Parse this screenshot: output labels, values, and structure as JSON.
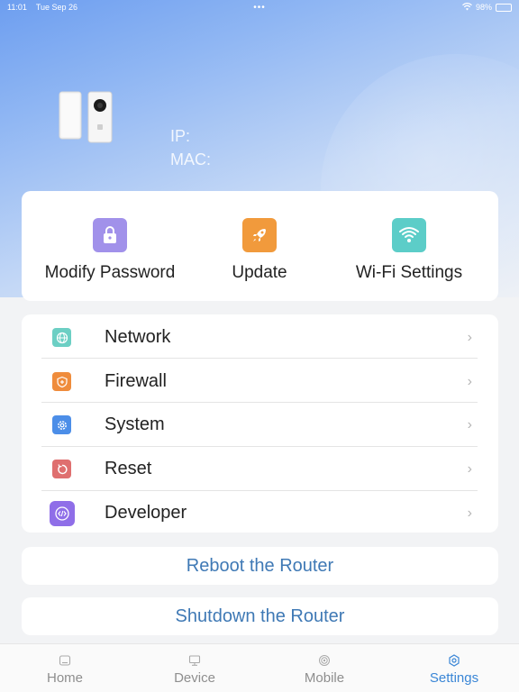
{
  "status_bar": {
    "time": "11:01",
    "date": "Tue Sep 26",
    "battery": "98%"
  },
  "device": {
    "ip_label": "IP:",
    "mac_label": "MAC:"
  },
  "quick_actions": [
    {
      "label": "Modify Password",
      "icon": "lock-icon",
      "color": "#a191ea"
    },
    {
      "label": "Update",
      "icon": "rocket-icon",
      "color": "#f19a3c"
    },
    {
      "label": "Wi-Fi Settings",
      "icon": "wifi-icon",
      "color": "#5ccdc8"
    }
  ],
  "menu": [
    {
      "label": "Network",
      "icon": "globe-icon",
      "color": "#6ccfc4"
    },
    {
      "label": "Firewall",
      "icon": "shield-icon",
      "color": "#ef8c3c"
    },
    {
      "label": "System",
      "icon": "gear-icon",
      "color": "#4c8ee8"
    },
    {
      "label": "Reset",
      "icon": "reset-icon",
      "color": "#df6f6f"
    },
    {
      "label": "Developer",
      "icon": "code-icon",
      "color": "#8f6ee8"
    }
  ],
  "actions": {
    "reboot": "Reboot the Router",
    "shutdown": "Shutdown the Router"
  },
  "tabs": [
    {
      "label": "Home",
      "icon": "home-icon"
    },
    {
      "label": "Device",
      "icon": "monitor-icon"
    },
    {
      "label": "Mobile",
      "icon": "signal-icon"
    },
    {
      "label": "Settings",
      "icon": "settings-icon"
    }
  ],
  "colors": {
    "accent": "#3a86d6",
    "button_text": "#3f79b5"
  }
}
